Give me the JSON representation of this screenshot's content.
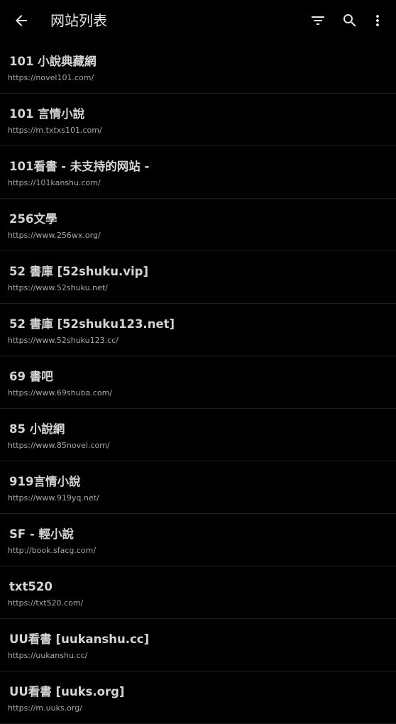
{
  "appbar": {
    "title": "网站列表",
    "icons": {
      "back": "arrow-back-icon",
      "filter": "filter-list-icon",
      "search": "search-icon",
      "more": "more-vert-icon"
    }
  },
  "sites": [
    {
      "name": "101 小說典藏網",
      "url": "https://novel101.com/"
    },
    {
      "name": "101 言情小說",
      "url": "https://m.txtxs101.com/"
    },
    {
      "name": "101看書 - 未支持的网站 -",
      "url": "https://101kanshu.com/"
    },
    {
      "name": "256文學",
      "url": "https://www.256wx.org/"
    },
    {
      "name": "52 書庫 [52shuku.vip]",
      "url": "https://www.52shuku.net/"
    },
    {
      "name": "52 書庫 [52shuku123.net]",
      "url": "https://www.52shuku123.cc/"
    },
    {
      "name": "69 書吧",
      "url": "https://www.69shuba.com/"
    },
    {
      "name": "85 小說網",
      "url": "https://www.85novel.com/"
    },
    {
      "name": "919言情小說",
      "url": "https://www.919yq.net/"
    },
    {
      "name": "SF - 輕小說",
      "url": "http://book.sfacg.com/"
    },
    {
      "name": "txt520",
      "url": "https://txt520.com/"
    },
    {
      "name": "UU看書 [uukanshu.cc]",
      "url": "https://uukanshu.cc/"
    },
    {
      "name": "UU看書 [uuks.org]",
      "url": "https://m.uuks.org/"
    }
  ],
  "colors": {
    "background": "#000000",
    "title_text": "#d4d4d4",
    "url_text": "#a8a8a8",
    "divider": "#1e1e1e"
  }
}
